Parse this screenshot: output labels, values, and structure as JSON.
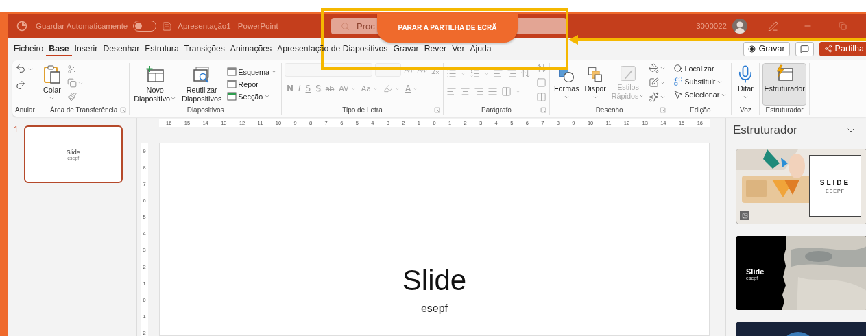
{
  "title_bar": {
    "autosave": {
      "label": "Guardar Automaticamente",
      "on": false
    },
    "document": "Apresentação1 - PowerPoint",
    "search": {
      "placeholder": "Proc"
    },
    "account": "3000022"
  },
  "stop_sharing": {
    "label": "PARAR A PARTILHA DE ECRÃ"
  },
  "menu_tabs": [
    {
      "label": "Ficheiro",
      "selected": false
    },
    {
      "label": "Base",
      "selected": true
    },
    {
      "label": "Inserir",
      "selected": false
    },
    {
      "label": "Desenhar",
      "selected": false
    },
    {
      "label": "Estrutura",
      "selected": false
    },
    {
      "label": "Transições",
      "selected": false
    },
    {
      "label": "Animações",
      "selected": false
    },
    {
      "label": "Apresentação de Diapositivos",
      "selected": false
    },
    {
      "label": "Gravar",
      "selected": false
    },
    {
      "label": "Rever",
      "selected": false
    },
    {
      "label": "Ver",
      "selected": false
    },
    {
      "label": "Ajuda",
      "selected": false
    }
  ],
  "header_buttons": [
    {
      "kind": "record",
      "label": "Gravar"
    },
    {
      "kind": "comment"
    },
    {
      "kind": "share",
      "label": "Partilha"
    }
  ],
  "ribbon": [
    {
      "kind": "undo",
      "label": "Anular",
      "launcher": false,
      "disabled": false
    },
    {
      "kind": "clipboard",
      "label": "Área de Transferência",
      "launcher": true,
      "disabled": false,
      "paste": "Colar"
    },
    {
      "kind": "slides",
      "label": "Diapositivos",
      "launcher": false,
      "disabled": false,
      "new_slide": [
        "Novo",
        "Diapositivo"
      ],
      "reuse": [
        "Reutilizar",
        "Diapositivos"
      ],
      "small": [
        {
          "label": "Esquema",
          "dropdown": true
        },
        {
          "label": "Repor",
          "dropdown": false
        },
        {
          "label": "Secção",
          "dropdown": true
        }
      ]
    },
    {
      "kind": "font",
      "label": "Tipo de Letra",
      "launcher": true,
      "disabled": true,
      "buttons": [
        {
          "kind": "bold",
          "label": "N"
        },
        {
          "kind": "italic",
          "label": "I"
        },
        {
          "kind": "underline",
          "label": "S"
        },
        {
          "kind": "shadow",
          "label": "S"
        },
        {
          "kind": "strike",
          "label": "ab"
        },
        {
          "kind": "spacing",
          "label": "AV"
        },
        {
          "kind": "case",
          "label": "Aa"
        },
        {
          "kind": "highlight"
        },
        {
          "kind": "color",
          "label": "A"
        }
      ]
    },
    {
      "kind": "paragraph",
      "label": "Parágrafo",
      "launcher": true,
      "disabled": true
    },
    {
      "kind": "drawing",
      "label": "Desenho",
      "launcher": true,
      "disabled": false,
      "buttons": [
        {
          "label": [
            "Formas"
          ],
          "disabled": false
        },
        {
          "label": [
            "Dispor"
          ],
          "disabled": false
        },
        {
          "label": [
            "Estilos",
            "Rápidos"
          ],
          "disabled": true
        }
      ]
    },
    {
      "kind": "editing",
      "label": "Edição",
      "launcher": false,
      "disabled": false,
      "items": [
        {
          "label": "Localizar",
          "dropdown": false
        },
        {
          "label": "Substituir",
          "dropdown": true
        },
        {
          "label": "Selecionar",
          "dropdown": true
        }
      ]
    },
    {
      "kind": "voice",
      "label": "Voz",
      "launcher": false,
      "disabled": false,
      "button": "Ditar"
    },
    {
      "kind": "designer",
      "label": "Estruturador",
      "launcher": false,
      "disabled": false,
      "button": "Estruturador",
      "selected": true
    }
  ],
  "slides": [
    {
      "number": "1",
      "title": "Slide",
      "subtitle": "esepf",
      "selected": true
    }
  ],
  "ruler": {
    "horizontal": [
      "16",
      "15",
      "14",
      "13",
      "12",
      "11",
      "10",
      "9",
      "8",
      "7",
      "6",
      "5",
      "4",
      "3",
      "2",
      "1",
      "0",
      "1",
      "2",
      "3",
      "4",
      "5",
      "6",
      "7",
      "8",
      "9",
      "10",
      "11",
      "12",
      "13",
      "14",
      "15",
      "16"
    ],
    "vertical": [
      "9",
      "8",
      "7",
      "6",
      "5",
      "4",
      "3",
      "2",
      "1",
      "0",
      "1",
      "2"
    ]
  },
  "slide": {
    "title": "Slide",
    "subtitle": "esepf"
  },
  "designer": {
    "title": "Estruturador",
    "designs": [
      {
        "kind": "card",
        "title": "SLIDE",
        "subtitle": "ESEPF"
      },
      {
        "kind": "torn",
        "title": "Slide",
        "subtitle": "esepf"
      },
      {
        "kind": "dark"
      }
    ]
  }
}
